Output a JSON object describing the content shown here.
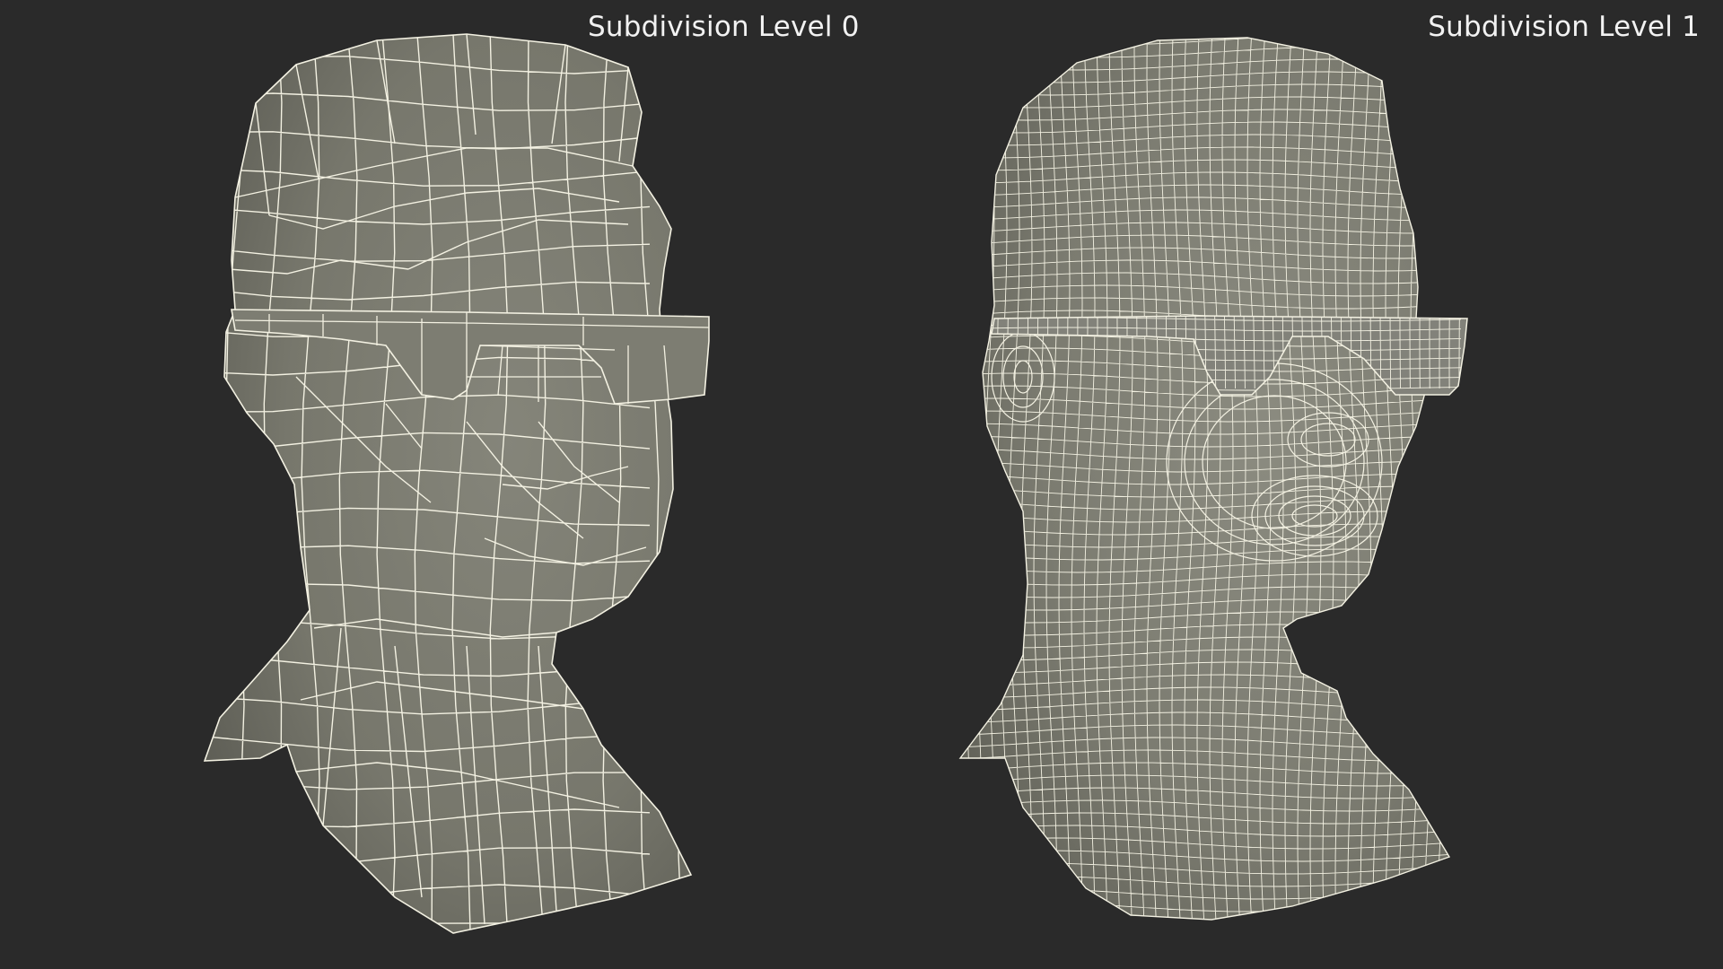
{
  "labels": {
    "left": "Subdivision Level 0",
    "right": "Subdivision Level 1"
  },
  "colors": {
    "background": "#2a2a2a",
    "mesh_fill": "#77776c",
    "mesh_shade": "#5f5f56",
    "wire": "#f3f1e2",
    "text": "#f2f2f2"
  }
}
